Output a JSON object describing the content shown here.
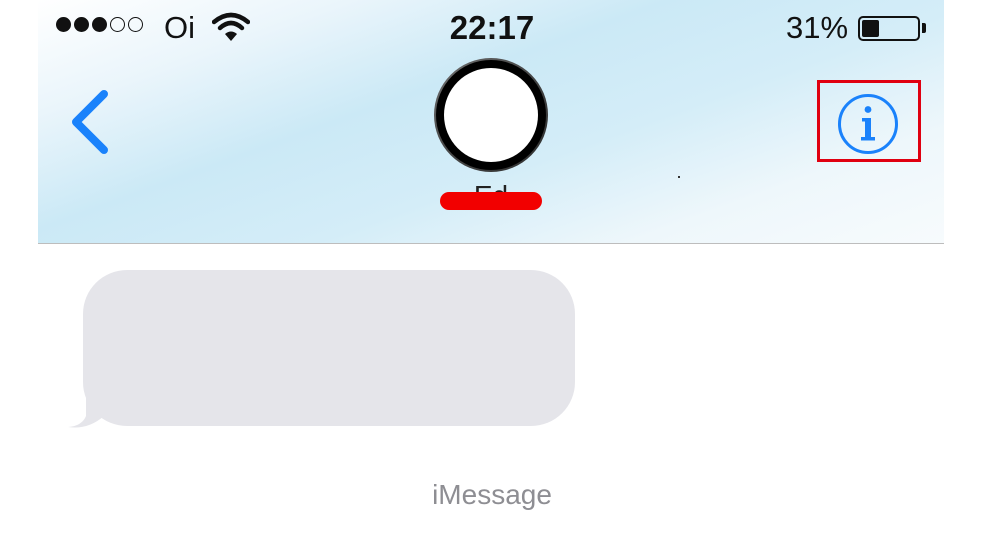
{
  "status_bar": {
    "signal_dots": [
      "full",
      "full",
      "full",
      "empty",
      "empty"
    ],
    "carrier": "Oi",
    "time": "22:17",
    "battery_percent": "31%",
    "battery_level": 0.31
  },
  "nav": {
    "contact_name": "Ed",
    "icons": {
      "back": "chevron-left-icon",
      "info": "info-circle-icon",
      "wifi": "wifi-icon",
      "battery": "battery-icon"
    }
  },
  "conversation": {
    "service_label": "iMessage"
  },
  "colors": {
    "accent": "#1a82fb",
    "bubble_incoming": "#e5e5ea",
    "redaction": "#f20000",
    "highlight": "#e00010",
    "label_gray": "#8e8e93"
  }
}
